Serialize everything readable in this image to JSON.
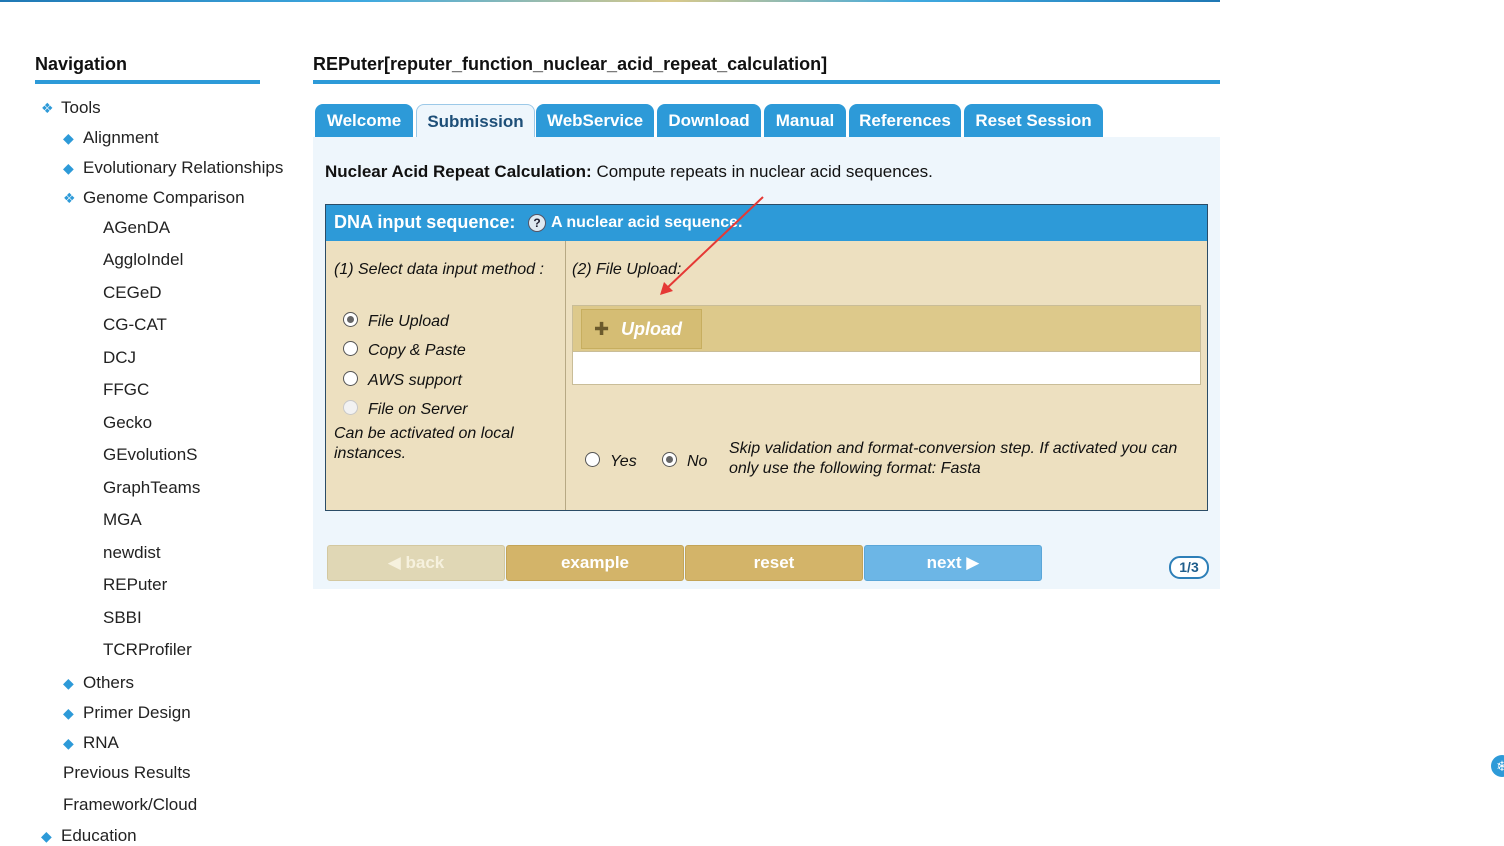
{
  "colors": {
    "accent": "#2d9ad8",
    "panel_bg": "#ede0c0",
    "button_gold": "#d3b469",
    "button_next": "#6cb6e6",
    "content_bg": "#eef6fc"
  },
  "nav": {
    "title": "Navigation",
    "tools": "Tools",
    "alignment": "Alignment",
    "evolutionary": "Evolutionary Relationships",
    "genome_comparison": "Genome Comparison",
    "genome_tools": [
      "AGenDA",
      "AggloIndel",
      "CEGeD",
      "CG-CAT",
      "DCJ",
      "FFGC",
      "Gecko",
      "GEvolutionS",
      "GraphTeams",
      "MGA",
      "newdist",
      "REPuter",
      "SBBI",
      "TCRProfiler"
    ],
    "others": "Others",
    "primer_design": "Primer Design",
    "rna": "RNA",
    "previous_results": "Previous Results",
    "framework_cloud": "Framework/Cloud",
    "education": "Education"
  },
  "page": {
    "title": "REPuter[reputer_function_nuclear_acid_repeat_calculation]"
  },
  "tabs": [
    "Welcome",
    "Submission",
    "WebService",
    "Download",
    "Manual",
    "References",
    "Reset Session"
  ],
  "active_tab": "Submission",
  "intro": {
    "bold": "Nuclear Acid Repeat Calculation:",
    "text": "Compute repeats in nuclear acid sequences."
  },
  "panel": {
    "label": "DNA input sequence:",
    "help_icon": "question-icon",
    "description": "A nuclear acid sequence.",
    "step1": "(1) Select data input method :",
    "step2": "(2) File Upload:",
    "methods": [
      {
        "label": "File Upload",
        "checked": true,
        "disabled": false
      },
      {
        "label": "Copy & Paste",
        "checked": false,
        "disabled": false
      },
      {
        "label": "AWS support",
        "checked": false,
        "disabled": false
      },
      {
        "label": "File on Server",
        "checked": false,
        "disabled": true
      }
    ],
    "local_note_1": "Can be activated on local",
    "local_note_2": "instances.",
    "upload_label": "Upload",
    "skip_yes": "Yes",
    "skip_no": "No",
    "skip_selected": "No",
    "skip_text_1": "Skip validation and format-conversion step. If activated you can",
    "skip_text_2": "only use the following format: Fasta"
  },
  "buttons": {
    "back": "◀ back",
    "example": "example",
    "reset": "reset",
    "next": "next ▶"
  },
  "pager": "1/3"
}
